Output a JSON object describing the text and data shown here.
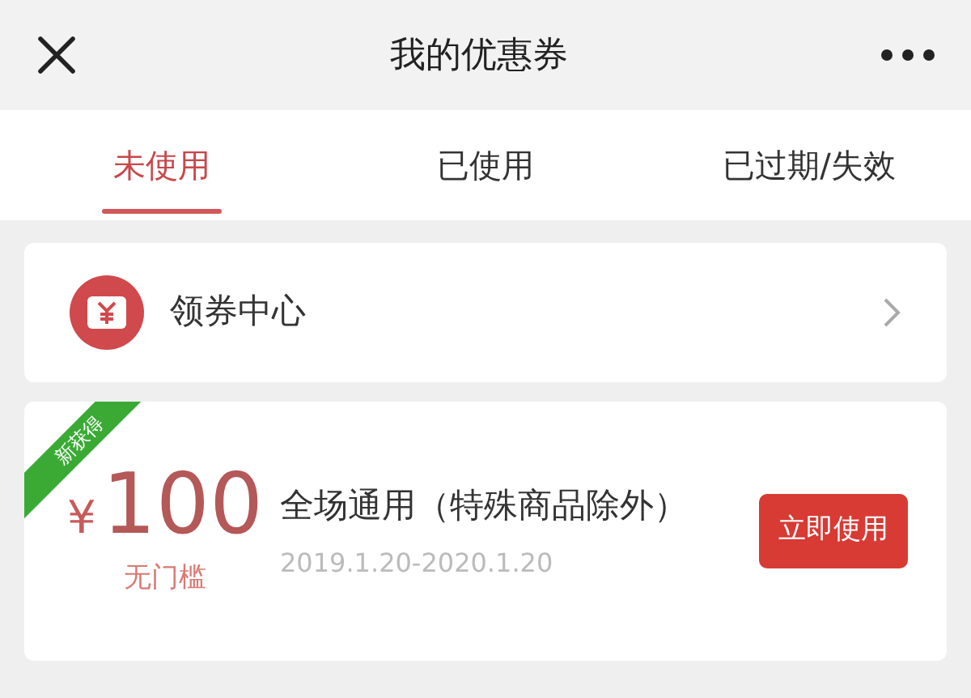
{
  "header": {
    "title": "我的优惠券"
  },
  "tabs": [
    {
      "label": "未使用",
      "selected": true
    },
    {
      "label": "已使用",
      "selected": false
    },
    {
      "label": "已过期/失效",
      "selected": false
    }
  ],
  "center_link": {
    "label": "领券中心"
  },
  "coupons": [
    {
      "ribbon": "新获得",
      "currency": "¥",
      "amount": "100",
      "condition": "无门槛",
      "title": "全场通用（特殊商品除外）",
      "validity": "2019.1.20-2020.1.20",
      "action": "立即使用"
    }
  ]
}
